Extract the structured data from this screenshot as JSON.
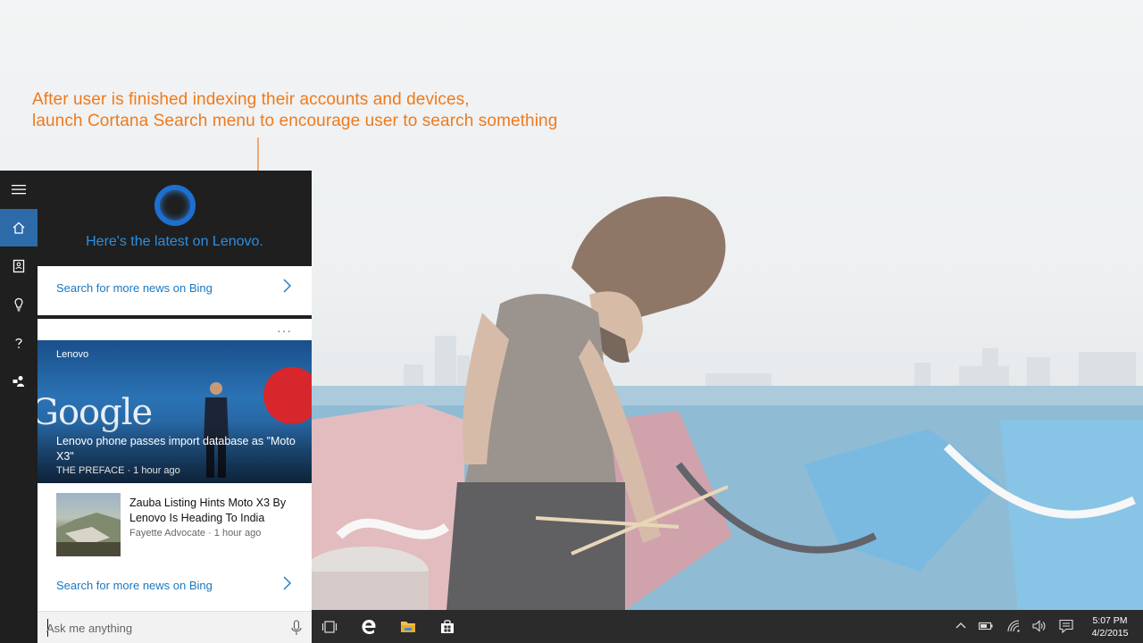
{
  "annotation": {
    "line1": "After user is finished  indexing  their accounts and devices,",
    "line2": "launch  Cortana Search menu  to encourage  user to search something"
  },
  "colors": {
    "annotation": "#f07a1a",
    "cortana_blue": "#2d8fe0",
    "link_blue": "#1a78c2",
    "rail_active": "#2d6aa8"
  },
  "cortana": {
    "greeting": "Here's the latest on Lenovo.",
    "search_more_top": "Search for more news on Bing",
    "more_options": "···",
    "news_hero": {
      "source": "Lenovo",
      "image_text": "Google",
      "headline": "Lenovo phone passes import database as \"Moto X3\"",
      "meta": "THE PREFACE · 1 hour ago"
    },
    "news_item": {
      "title": "Zauba Listing Hints Moto X3 By Lenovo Is Heading To India",
      "meta": "Fayette Advocate · 1 hour ago"
    },
    "search_more_bottom": "Search for more news on Bing",
    "ask_placeholder": "Ask me anything"
  },
  "rail": {
    "items": [
      "menu-icon",
      "home-icon",
      "notebook-icon",
      "lightbulb-icon",
      "help-icon",
      "feedback-icon"
    ]
  },
  "taskbar": {
    "apps": [
      "task-view-icon",
      "edge-icon",
      "file-explorer-icon",
      "store-icon"
    ],
    "tray": [
      "chevron-up-icon",
      "battery-icon",
      "wifi-icon",
      "volume-icon",
      "action-center-icon"
    ],
    "time": "5:07 PM",
    "date": "4/2/2015"
  }
}
